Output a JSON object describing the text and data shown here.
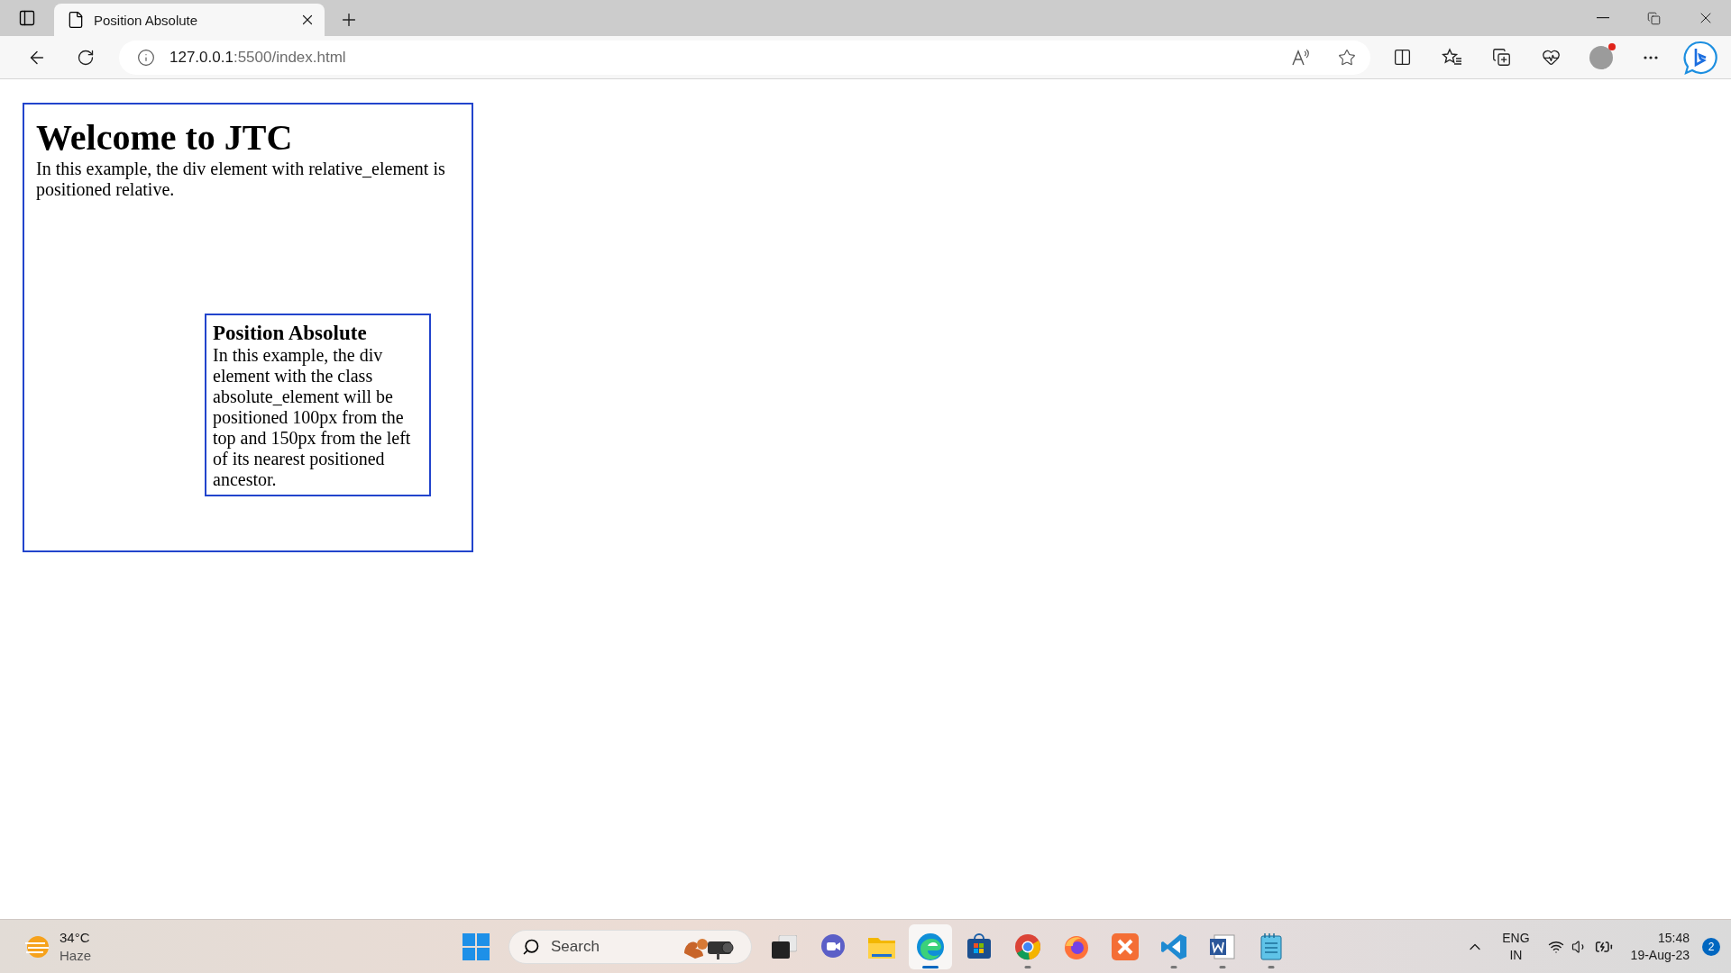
{
  "browser": {
    "tabs": [
      {
        "title": "Position Absolute",
        "selected": true
      }
    ],
    "address": {
      "host": "127.0.0.1",
      "path": ":5500/index.html"
    },
    "profile_notification": true
  },
  "page": {
    "heading": "Welcome to JTC",
    "paragraph": "In this example, the div element with relative_element is positioned relative.",
    "absolute_box": {
      "heading": "Position Absolute",
      "paragraph": "In this example, the div element with the class absolute_element will be positioned 100px from the top and 150px from the left of its nearest positioned ancestor."
    }
  },
  "taskbar": {
    "weather": {
      "temperature": "34°C",
      "condition": "Haze"
    },
    "search": {
      "placeholder": "Search"
    },
    "apps": [
      {
        "kind": "start",
        "selected": false,
        "running": false
      },
      {
        "kind": "taskview",
        "selected": false,
        "running": false
      },
      {
        "kind": "chat",
        "selected": false,
        "running": false
      },
      {
        "kind": "explorer",
        "selected": false,
        "running": false
      },
      {
        "kind": "edge",
        "selected": true,
        "running": true
      },
      {
        "kind": "store",
        "selected": false,
        "running": false
      },
      {
        "kind": "chrome",
        "selected": false,
        "running": true
      },
      {
        "kind": "firefox",
        "selected": false,
        "running": false
      },
      {
        "kind": "xampp",
        "selected": false,
        "running": false
      },
      {
        "kind": "vscode",
        "selected": false,
        "running": true
      },
      {
        "kind": "word",
        "selected": false,
        "running": true
      },
      {
        "kind": "notepad",
        "selected": false,
        "running": true
      }
    ],
    "tray": {
      "language": "ENG",
      "region": "IN",
      "time": "15:48",
      "date": "19-Aug-23",
      "notifications": "2"
    }
  }
}
